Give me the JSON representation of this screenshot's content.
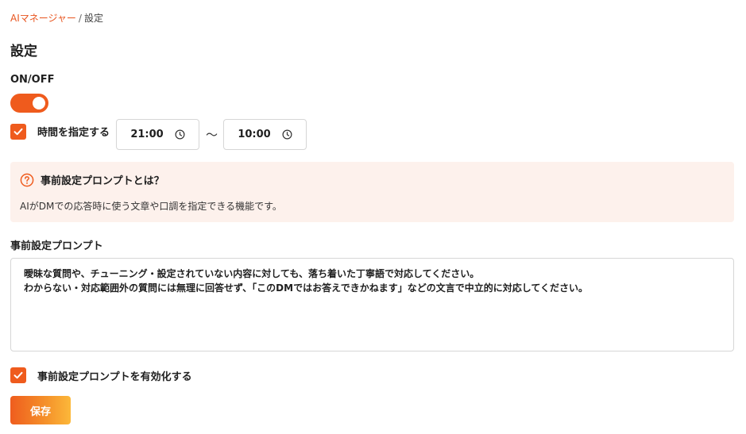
{
  "breadcrumb": {
    "parent": "AIマネージャー",
    "separator": "/",
    "current": "設定"
  },
  "page_title": "設定",
  "onoff": {
    "label": "ON/OFF",
    "enabled": true,
    "toggle_icon": "toggle-switch"
  },
  "schedule": {
    "checked": true,
    "label": "時間を指定する",
    "start_time": "21:00",
    "separator": "〜",
    "end_time": "10:00",
    "time_icon": "clock-icon"
  },
  "info": {
    "icon": "question-circle-icon",
    "title": "事前設定プロンプトとは？",
    "body": "AIがDMでの応答時に使う文章や口調を指定できる機能です。"
  },
  "prompt": {
    "label": "事前設定プロンプト",
    "line1": "曖昧な質問や、チューニング・設定されていない内容に対しても、落ち着いた丁寧語で対応してください。",
    "line2": "わからない・対応範囲外の質問には無理に回答せず、「このDMではお答えできかねます」などの文言で中立的に対応してください。"
  },
  "enable_prompt": {
    "checked": true,
    "label": "事前設定プロンプトを有効化する"
  },
  "save_label": "保存",
  "colors": {
    "accent": "#ef5b1d",
    "info_bg": "#fdf1ec",
    "border": "#d6d6d6"
  }
}
